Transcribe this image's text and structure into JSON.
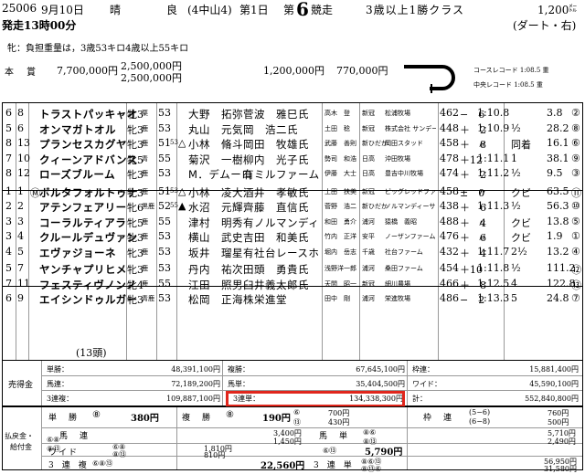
{
  "header": {
    "race_id": "25006",
    "date": "9月10日",
    "weather": "晴",
    "track": "良",
    "meeting": "(4中山4)",
    "day": "第1日",
    "race_prefix": "第",
    "race_no": "6",
    "race_suffix": "競走",
    "class": "3歳以上1勝クラス",
    "distance": "1,200",
    "distance_unit": "㍍",
    "course": "(ダート・右)",
    "start_time": "発走13時00分"
  },
  "weight_note": "牝：負担重量は，3歳53キロ4歳以上55キロ",
  "prize": {
    "label": "本　賞",
    "first": "7,700,000円",
    "add1": "2,500,000円",
    "add2": "2,500,000円",
    "third": "1,200,000円",
    "fourth": "770,000円"
  },
  "records": {
    "course": "コースレコード 1:08.5 重",
    "track": "中央レコード 1:08.5 重"
  },
  "horses": [
    {
      "waku": "6",
      "no": "8",
      "mark": "",
      "name": "トラストパッキャオ",
      "sex": "牝3",
      "color": "栗",
      "wt": "53",
      "wt_sup": "",
      "jm": "",
      "jockey": "大野　拓弥",
      "trainer": "菅波　雅巳氏",
      "breeder": "高木　登",
      "region": "新冠",
      "farm": "松浦牧場",
      "bw": "462",
      "diff": "−　6",
      "time": "1:10.8",
      "margin": "",
      "odds": "3.8",
      "pop": "②"
    },
    {
      "waku": "5",
      "no": "6",
      "mark": "",
      "name": "オンマガトオル",
      "sex": "牝3",
      "color": "鹿",
      "wt": "53",
      "wt_sup": "",
      "jm": "",
      "jockey": "丸山　元気",
      "trainer": "岡　浩二氏",
      "breeder": "土田　稔",
      "region": "新冠",
      "farm": "株式会社 サンデーヒルズ",
      "bw": "448",
      "diff": "＋　2",
      "time": "1:10.9",
      "margin": "½",
      "odds": "28.2",
      "pop": "⑧"
    },
    {
      "waku": "8",
      "no": "13",
      "mark": "",
      "name": "プランセスカグヤ",
      "sex": "牝3",
      "color": "鹿",
      "wt": "51",
      "wt_sup": "53",
      "jm": "△",
      "jockey": "小林　脩斗",
      "trainer": "岡田　牧雄氏",
      "breeder": "武藤　善則",
      "region": "新ひだか",
      "farm": "岡田スタッド",
      "bw": "458",
      "diff": "＋　8",
      "time": "〃",
      "margin": "同着",
      "odds": "16.1",
      "pop": "⑥"
    },
    {
      "waku": "7",
      "no": "10",
      "mark": "",
      "name": "クィーンアドバンス",
      "sex": "牝5",
      "color": "青",
      "wt": "55",
      "wt_sup": "",
      "jm": "",
      "jockey": "菊沢　一樹",
      "trainer": "柳内　光子氏",
      "breeder": "勢司　和浩",
      "region": "日高",
      "farm": "沖田牧場",
      "bw": "478",
      "diff": "＋12",
      "time": "1:11.1",
      "margin": "1",
      "odds": "38.1",
      "pop": "⑨"
    },
    {
      "waku": "8",
      "no": "12",
      "mark": "",
      "name": "ローズブルーム",
      "sex": "牝3",
      "color": "鹿",
      "wt": "53",
      "wt_sup": "",
      "jm": "",
      "jockey": "M．デムーロ",
      "trainer": "有ミルファーム",
      "breeder": "伊藤　大士",
      "region": "日高",
      "farm": "豊吉中川牧場",
      "bw": "474",
      "diff": "＋　2",
      "time": "1:11.2",
      "margin": "½",
      "odds": "9.5",
      "pop": "③"
    },
    {
      "waku": "1",
      "no": "1",
      "mark": "Ⓜ",
      "name": "ボルタフォルトゥナ",
      "sex": "牝3",
      "color": "鹿",
      "wt": "51",
      "wt_sup": "53",
      "jm": "△",
      "jockey": "小林　凌大",
      "trainer": "酒井　孝敏氏",
      "breeder": "土田　扶美",
      "region": "新冠",
      "farm": "ビッグレッドファーム",
      "bw": "458",
      "diff": "±　0",
      "time": "〃",
      "margin": "クビ",
      "odds": "63.5",
      "pop": "⑪"
    },
    {
      "waku": "2",
      "no": "2",
      "mark": "",
      "name": "アテンフェアリー",
      "sex": "牝6",
      "color": "黒鹿",
      "wt": "52",
      "wt_sup": "55",
      "jm": "▲",
      "jockey": "水沼　元輝",
      "trainer": "齊藤　直信氏",
      "breeder": "菅野　浩二",
      "region": "新ひだか",
      "farm": "ノルマンディーサラブレッドレーシング",
      "bw": "438",
      "diff": "＋　6",
      "time": "1:11.3",
      "margin": "½",
      "odds": "56.3",
      "pop": "⑩"
    },
    {
      "waku": "3",
      "no": "3",
      "mark": "",
      "name": "コーラルティアラ",
      "sex": "牝5",
      "color": "鹿",
      "wt": "55",
      "wt_sup": "",
      "jm": "",
      "jockey": "津村　明秀",
      "trainer": "有ノルマンディーサラブレッドレーシング",
      "breeder": "和田　勇介",
      "region": "浦河",
      "farm": "猿橋　義昭",
      "bw": "488",
      "diff": "＋　4",
      "time": "〃",
      "margin": "クビ",
      "odds": "13.8",
      "pop": "⑤"
    },
    {
      "waku": "3",
      "no": "4",
      "mark": "",
      "name": "クルールデュヴァン",
      "sex": "牝3",
      "color": "鹿",
      "wt": "53",
      "wt_sup": "",
      "jm": "",
      "jockey": "横山　武史",
      "trainer": "吉田　和美氏",
      "breeder": "竹内　正洋",
      "region": "安平",
      "farm": "ノーザンファーム",
      "bw": "476",
      "diff": "＋　6",
      "time": "〃",
      "margin": "クビ",
      "odds": "1.9",
      "pop": "①"
    },
    {
      "waku": "4",
      "no": "5",
      "mark": "",
      "name": "エヴァジョーネ",
      "sex": "牝3",
      "color": "鹿",
      "wt": "53",
      "wt_sup": "",
      "jm": "",
      "jockey": "坂井　瑠星",
      "trainer": "有社台レースホース",
      "breeder": "堀内　岳志",
      "region": "千歳",
      "farm": "社台ファーム",
      "bw": "432",
      "diff": "＋　4",
      "time": "1:11.7",
      "margin": "2½",
      "odds": "13.2",
      "pop": "④"
    },
    {
      "waku": "5",
      "no": "7",
      "mark": "",
      "name": "ヤンチャプリヒメ",
      "sex": "牝3",
      "color": "鹿",
      "wt": "53",
      "wt_sup": "",
      "jm": "",
      "jockey": "丹内　祐次",
      "trainer": "田頭　勇貴氏",
      "breeder": "浅野洋一郎",
      "region": "浦河",
      "farm": "桑田ファーム",
      "bw": "454",
      "diff": "＋10",
      "time": "1:11.8",
      "margin": "½",
      "odds": "111.2",
      "pop": "⑫"
    },
    {
      "waku": "7",
      "no": "11",
      "mark": "",
      "name": "フェスティヴノンノ",
      "sex": "牝4",
      "color": "鹿",
      "wt": "55",
      "wt_sup": "",
      "jm": "",
      "jockey": "江田　照男",
      "trainer": "臼井義太郎氏",
      "breeder": "天間　昭一",
      "region": "新冠",
      "farm": "細川農場",
      "bw": "466",
      "diff": "＋　8",
      "time": "1:12.5",
      "margin": "4",
      "odds": "122.8",
      "pop": "⑬"
    },
    {
      "waku": "6",
      "no": "9",
      "mark": "",
      "name": "エイシンドゥルガー",
      "sex": "牝3",
      "color": "青鹿",
      "wt": "53",
      "wt_sup": "",
      "jm": "",
      "jockey": "松岡　正海",
      "trainer": "株栄進堂",
      "breeder": "田中　剛",
      "region": "浦河",
      "farm": "栄進牧場",
      "bw": "486",
      "diff": "−　2",
      "time": "1:13.3",
      "margin": "5",
      "odds": "24.8",
      "pop": "⑦"
    }
  ],
  "runners_total": "(13頭)",
  "sales": {
    "label": "売得金",
    "tansho_l": "単勝：",
    "tansho_v": "48,391,100円",
    "fukusho_l": "複勝：",
    "fukusho_v": "67,645,100円",
    "wakuren_l": "枠連：",
    "wakuren_v": "15,881,400円",
    "umaren_l": "馬連：",
    "umaren_v": "72,189,200円",
    "umatan_l": "馬単：",
    "umatan_v": "35,404,500円",
    "wide_l": "ワイド：",
    "wide_v": "45,590,100円",
    "sanrenpuku_l": "3連複：",
    "sanrenpuku_v": "109,887,100円",
    "sanrentan_l": "3連単：",
    "sanrentan_v": "134,338,300円",
    "total_l": "計：",
    "total_v": "552,840,800円"
  },
  "payout": {
    "label1": "払戻金・",
    "label2": "給付金",
    "tansho_l": "単　勝",
    "tansho_n": "⑧",
    "tansho_v": "380円",
    "fukusho_l": "複　勝",
    "fukusho_n1": "⑧",
    "fukusho_v1": "190円",
    "fukusho_n2": "⑥",
    "fukusho_n3": "⑬",
    "fukusho_v2": "700円",
    "fukusho_v3": "430円",
    "wakuren_l": "枠　連",
    "wakuren_n1": "(5−6)",
    "wakuren_n2": "(6−8)",
    "wakuren_v1": "760円",
    "wakuren_v2": "500円",
    "umaren_l": "馬　連",
    "umaren_n1": "⑥⑧",
    "umaren_n2": "⑧⑬",
    "umaren_v1": "3,400円",
    "umaren_v2": "1,450円",
    "umatan_l": "馬　単",
    "umatan_n1": "⑧⑥",
    "umatan_n2": "⑧⑬",
    "umatan_v1": "5,710円",
    "umatan_v2": "2,490円",
    "wide_l": "ワイド",
    "wide_n1": "⑥⑧",
    "wide_n2": "⑧⑬",
    "wide_v1": "1,810円",
    "wide_v2": "810円",
    "wide_n3": "⑥⑬",
    "wide_v3": "5,790円",
    "sanrenpuku_l": "3　連　複",
    "sanrenpuku_n": "⑥⑧⑬",
    "sanrenpuku_v": "22,560円",
    "sanrentan_l": "3　連　単",
    "sanrentan_n1": "⑧⑥⑬",
    "sanrentan_n2": "⑧⑬⑥",
    "sanrentan_v1": "56,950円",
    "sanrentan_v2": "31,580円"
  },
  "highlight_color": "#e0261c"
}
